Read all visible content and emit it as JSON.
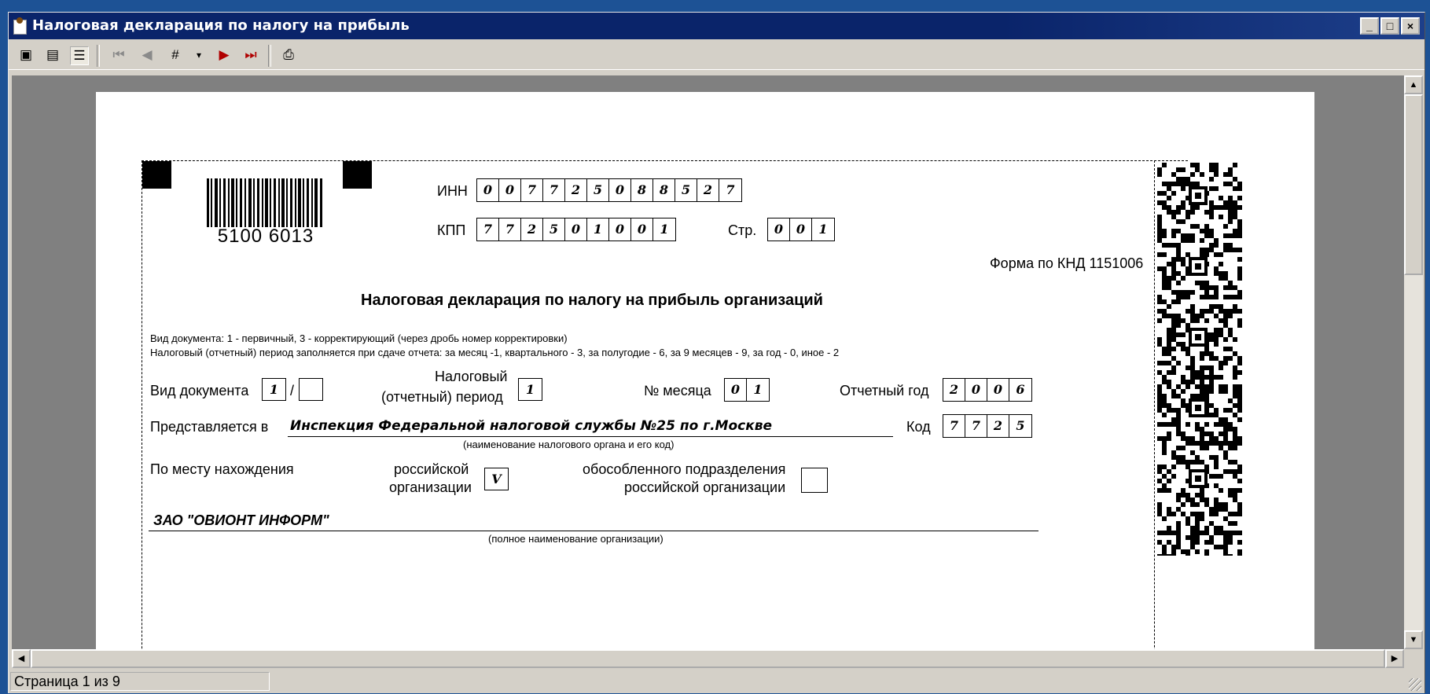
{
  "window": {
    "title": "Налоговая декларация по налогу на прибыль",
    "buttons": {
      "minimize": "_",
      "maximize": "□",
      "close": "×"
    }
  },
  "toolbar": {
    "icons": [
      "page-view-icon",
      "page-width-icon",
      "whole-page-icon",
      "first-page-icon",
      "prev-page-icon",
      "goto-page-icon",
      "dropdown-icon",
      "next-page-icon",
      "last-page-icon",
      "print-icon"
    ]
  },
  "status": {
    "page_info": "Страница 1 из 9"
  },
  "document": {
    "barcode_number": "5100 6013",
    "inn_label": "ИНН",
    "inn_digits": [
      "0",
      "0",
      "7",
      "7",
      "2",
      "5",
      "0",
      "8",
      "8",
      "5",
      "2",
      "7"
    ],
    "kpp_label": "КПП",
    "kpp_digits": [
      "7",
      "7",
      "2",
      "5",
      "0",
      "1",
      "0",
      "0",
      "1"
    ],
    "page_label": "Стр.",
    "page_digits": [
      "0",
      "0",
      "1"
    ],
    "form_code": "Форма по КНД  1151006",
    "title": "Налоговая декларация по налогу на прибыль организаций",
    "note1": "Вид документа: 1 - первичный, 3 - корректирующий (через дробь номер корректировки)",
    "note2": "Налоговый (отчетный) период заполняется при сдаче отчета: за месяц -1, квартального - 3, за полугодие - 6, за 9 месяцев - 9, за год - 0, иное - 2",
    "doc_type_label": "Вид документа",
    "doc_type_value": "1",
    "doc_type_slash": "/",
    "doc_type_correction": "",
    "period_label_1": "Налоговый",
    "period_label_2": "(отчетный) период",
    "period_value": "1",
    "month_label": "№ месяца",
    "month_digits": [
      "0",
      "1"
    ],
    "year_label": "Отчетный год",
    "year_digits": [
      "2",
      "0",
      "0",
      "6"
    ],
    "submitted_label": "Представляется в",
    "submitted_value": "Инспекция Федеральной налоговой службы №25 по г.Москве",
    "code_label": "Код",
    "code_digits": [
      "7",
      "7",
      "2",
      "5"
    ],
    "authority_caption": "(наименование налогового органа и его код)",
    "location_label": "По месту нахождения",
    "russian_org_1": "российской",
    "russian_org_2": "организации",
    "russian_org_value": "V",
    "branch_1": "обособленного подразделения",
    "branch_2": "российской организации",
    "branch_value": "",
    "org_name": "ЗАО \"ОВИОНТ ИНФОРМ\"",
    "org_caption": "(полное наименование организации)"
  }
}
